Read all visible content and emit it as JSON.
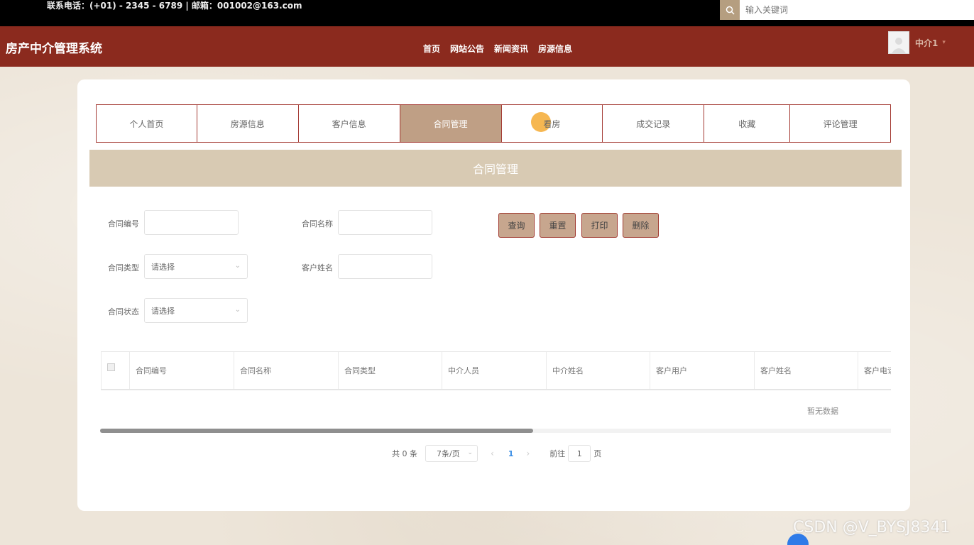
{
  "topbar": {
    "contact": "联系电话：(+01) - 2345 - 6789 | 邮箱：001002@163.com",
    "search_placeholder": "输入关键词"
  },
  "header": {
    "brand": "房产中介管理系统",
    "nav": [
      "首页",
      "网站公告",
      "新闻资讯",
      "房源信息"
    ],
    "user_name": "中介1"
  },
  "tabs": [
    {
      "label": "个人首页",
      "active": false
    },
    {
      "label": "房源信息",
      "active": false
    },
    {
      "label": "客户信息",
      "active": false
    },
    {
      "label": "合同管理",
      "active": true
    },
    {
      "label": "看房",
      "active": false
    },
    {
      "label": "成交记录",
      "active": false
    },
    {
      "label": "收藏",
      "active": false
    },
    {
      "label": "评论管理",
      "active": false
    }
  ],
  "section_title": "合同管理",
  "form": {
    "contract_no_label": "合同编号",
    "contract_name_label": "合同名称",
    "contract_type_label": "合同类型",
    "customer_name_label": "客户姓名",
    "contract_status_label": "合同状态",
    "select_placeholder": "请选择"
  },
  "buttons": {
    "query": "查询",
    "reset": "重置",
    "print": "打印",
    "delete": "删除"
  },
  "table": {
    "columns": [
      "合同编号",
      "合同名称",
      "合同类型",
      "中介人员",
      "中介姓名",
      "客户用户",
      "客户姓名",
      "客户电话"
    ],
    "empty_text": "暂无数据"
  },
  "pager": {
    "total": "共 0 条",
    "page_size": "7条/页",
    "current_page": "1",
    "goto_label": "前往",
    "goto_value": "1",
    "page_unit": "页"
  },
  "watermark": "CSDN @V_BYSJ8341",
  "colors": {
    "header_bg": "#8b2a1e",
    "active_tab": "#bf9f85",
    "section_bg": "#d8cab3",
    "button_bg": "#c7a68e"
  }
}
